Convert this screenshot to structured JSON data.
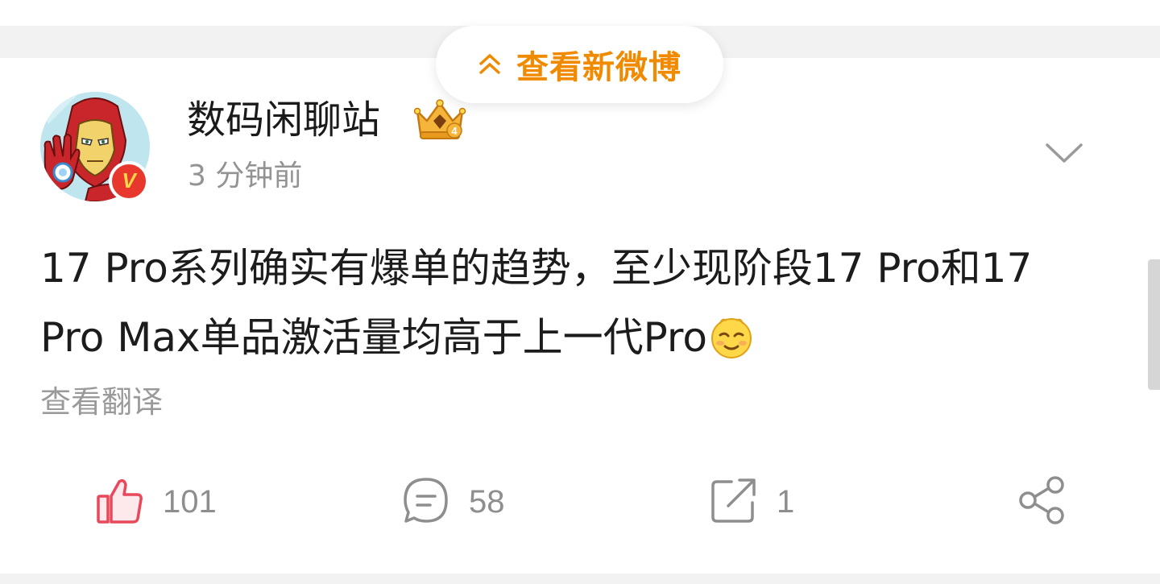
{
  "new_posts_pill": {
    "label": "查看新微博",
    "icon": "double-chevron-up-icon",
    "color": "#f08a00"
  },
  "post": {
    "author": {
      "name": "数码闲聊站",
      "avatar": "ironman-avatar",
      "verified_badge": "V",
      "verified_color": "#e8372c",
      "level_badge": "crown-badge-icon",
      "level": "4"
    },
    "timestamp": "3 分钟前",
    "more_icon": "chevron-down-icon",
    "text_lines": [
      "17 Pro系列确实有爆单的趋势，至少现阶段17 Pro和17",
      "Pro Max单品激活量均高于上一代Pro"
    ],
    "emoji": "smirk-emoji",
    "translate_label": "查看翻译",
    "actions": {
      "like": {
        "icon": "thumbs-up-icon",
        "count": "101",
        "color": "#e8485a"
      },
      "comment": {
        "icon": "comment-icon",
        "count": "58"
      },
      "repost": {
        "icon": "repost-icon",
        "count": "1"
      },
      "share": {
        "icon": "share-icon"
      }
    }
  }
}
